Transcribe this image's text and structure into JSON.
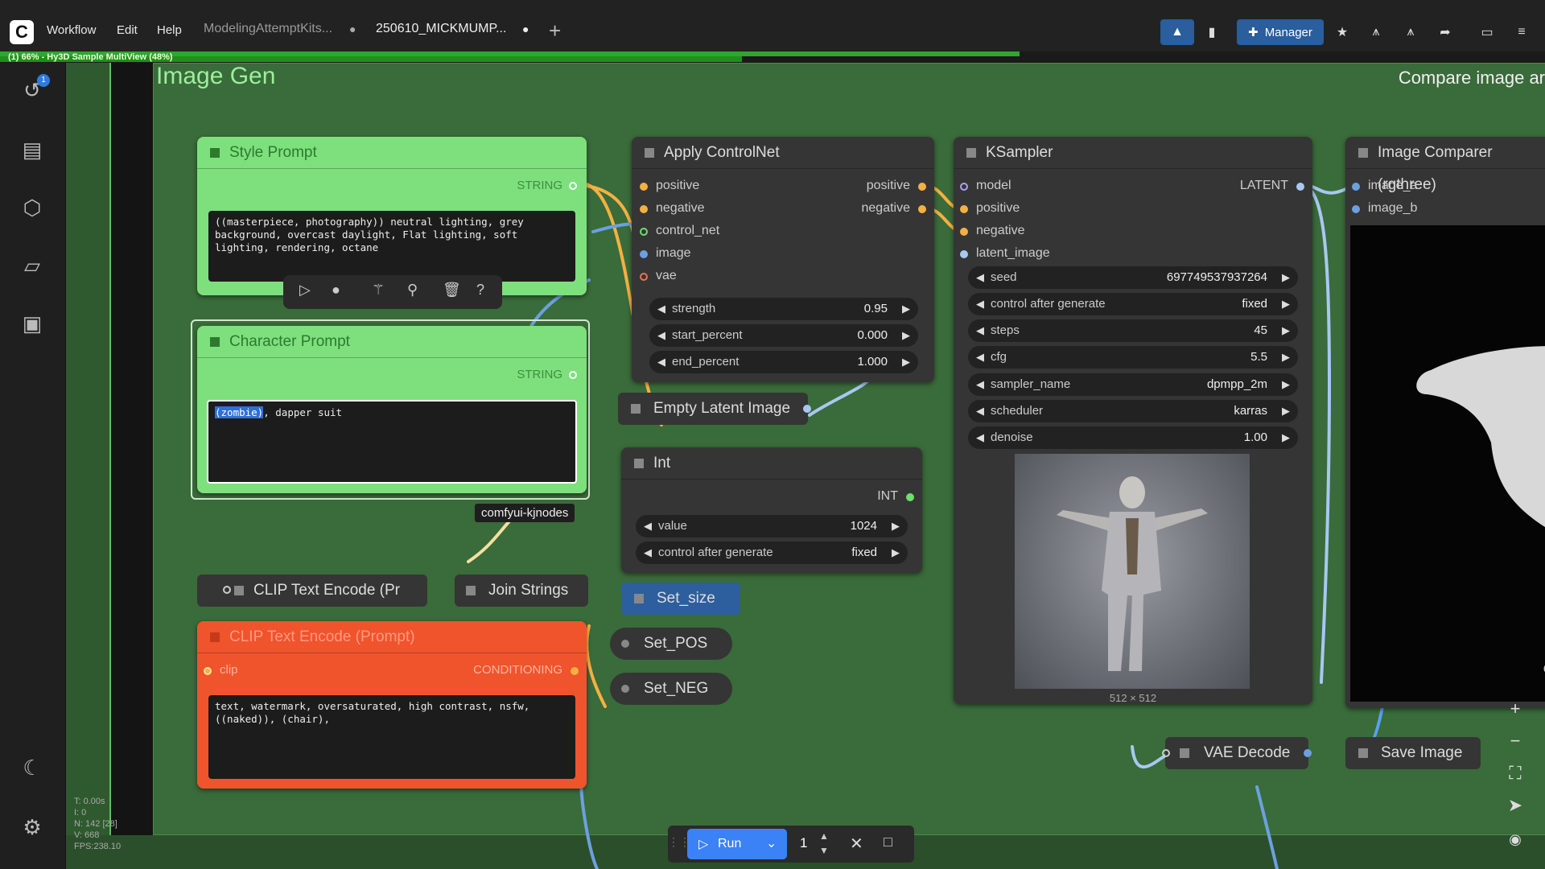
{
  "topbar": {
    "logo": "C",
    "menu": [
      "Workflow",
      "Edit",
      "Help"
    ],
    "tabs": [
      {
        "label": "ModelingAttemptKits..."
      },
      {
        "label": "250610_MICKMUMP..."
      }
    ],
    "manager_label": "Manager",
    "progress_text": "(1) 66% - Hy3D Sample MultiView (48%)",
    "progress_fraction": 0.66,
    "progress_sub_fraction": 0.48
  },
  "sidebar": {
    "badge": "1"
  },
  "canvas": {
    "group_title": "Image Gen",
    "compare_title": "Compare image ar",
    "stats": [
      "T: 0.00s",
      "I: 0",
      "N: 142 [28]",
      "V: 668",
      "FPS:238.10"
    ]
  },
  "style_prompt": {
    "title": "Style Prompt",
    "output": "STRING",
    "text": "((masterpiece, photography)) neutral lighting, grey background, overcast daylight, Flat lighting, soft lighting, rendering, octane"
  },
  "character_prompt": {
    "title": "Character Prompt",
    "output": "STRING",
    "highlight": "(zombie)",
    "text": ", dapper suit"
  },
  "toolbox_tooltip": "comfyui-kjnodes",
  "clip_text_encode_small": {
    "title": "CLIP Text Encode (Pr"
  },
  "join_strings": {
    "title": "Join Strings"
  },
  "clip_neg": {
    "title": "CLIP Text Encode (Prompt)",
    "input": "clip",
    "output": "CONDITIONING",
    "text": "text, watermark, oversaturated, high contrast, nsfw, ((naked)), (chair),"
  },
  "apply_controlnet": {
    "title": "Apply ControlNet",
    "inputs": [
      "positive",
      "negative",
      "control_net",
      "image",
      "vae"
    ],
    "outputs": [
      "positive",
      "negative"
    ],
    "widgets": [
      {
        "label": "strength",
        "value": "0.95"
      },
      {
        "label": "start_percent",
        "value": "0.000"
      },
      {
        "label": "end_percent",
        "value": "1.000"
      }
    ]
  },
  "empty_latent": {
    "title": "Empty Latent Image"
  },
  "int_node": {
    "title": "Int",
    "output": "INT",
    "widgets": [
      {
        "label": "value",
        "value": "1024"
      },
      {
        "label": "control after generate",
        "value": "fixed"
      }
    ]
  },
  "set_nodes": [
    "Set_size",
    "Set_POS",
    "Set_NEG"
  ],
  "ksampler": {
    "title": "KSampler",
    "inputs": [
      "model",
      "positive",
      "negative",
      "latent_image"
    ],
    "output": "LATENT",
    "widgets": [
      {
        "label": "seed",
        "value": "697749537937264"
      },
      {
        "label": "control after generate",
        "value": "fixed"
      },
      {
        "label": "steps",
        "value": "45"
      },
      {
        "label": "cfg",
        "value": "5.5"
      },
      {
        "label": "sampler_name",
        "value": "dpmpp_2m"
      },
      {
        "label": "scheduler",
        "value": "karras"
      },
      {
        "label": "denoise",
        "value": "1.00"
      }
    ],
    "preview_size": "512 × 512"
  },
  "image_comparer": {
    "title": "Image Comparer (rgthree)",
    "inputs": [
      "image_a",
      "image_b"
    ]
  },
  "vae_decode": {
    "title": "VAE Decode"
  },
  "save_image": {
    "title": "Save Image"
  },
  "runbar": {
    "run_label": "Run",
    "count": "1"
  },
  "colors": {
    "canvas": "#2b4f2b",
    "group": "#3a6b3a",
    "green_node": "#7de07d",
    "red_node": "#f0542c",
    "accent_blue": "#2a5e9c"
  }
}
